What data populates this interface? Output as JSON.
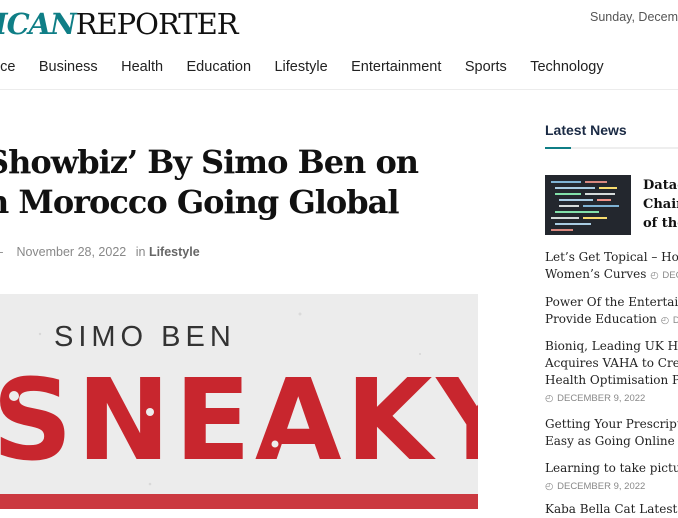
{
  "site": {
    "logo_part1": "ICAN",
    "logo_part2": "REPORTER",
    "date": "Sunday, Decemb"
  },
  "nav": {
    "items": [
      "nce",
      "Business",
      "Health",
      "Education",
      "Lifestyle",
      "Entertainment",
      "Sports",
      "Technology"
    ]
  },
  "article": {
    "title_line1": "Showbiz’ By Simo Ben on",
    "title_line2": "n Morocco Going Global",
    "dash": "–",
    "date": "November 28, 2022",
    "in_label": "in",
    "category": "Lifestyle"
  },
  "hero": {
    "subtitle": "SIMO BEN",
    "big_text": "SNEAKY"
  },
  "sidebar": {
    "title": "Latest News",
    "featured_lines": [
      "Data-",
      "Chain",
      "of the"
    ],
    "items": [
      {
        "line1": "Let’s Get Topical – How",
        "line2": "Women’s Curves",
        "date": "DECE",
        "inline_date": true
      },
      {
        "line1": "Power Of the Entertainm",
        "line2": "Provide Education",
        "date": "DE",
        "inline_date": true
      },
      {
        "line1": "Bioniq, Leading UK Heal",
        "line2": "Acquires VAHA to Create",
        "line3": "Health Optimisation Plat",
        "date": "DECEMBER 9, 2022",
        "inline_date": false
      },
      {
        "line1": "Getting Your Prescriptio",
        "line2": "Easy as Going Online",
        "date": "",
        "inline_date": true
      },
      {
        "line1": "Learning to take picture",
        "date": "DECEMBER 9, 2022",
        "inline_date": false
      },
      {
        "line1": "Kaba Bella Cat Latest Ek",
        "date": "",
        "inline_date": false
      }
    ]
  },
  "colors": {
    "accent": "#0f7e86",
    "hero_red": "#c8262e"
  }
}
